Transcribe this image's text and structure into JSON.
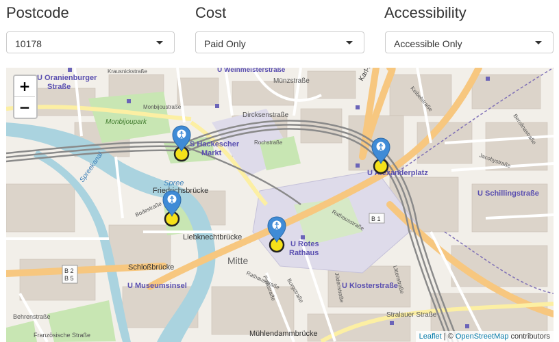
{
  "filters": {
    "postcode": {
      "label": "Postcode",
      "value": "10178"
    },
    "cost": {
      "label": "Cost",
      "value": "Paid Only"
    },
    "accessibility": {
      "label": "Accessibility",
      "value": "Accessible Only"
    }
  },
  "map": {
    "zoom_in": "+",
    "zoom_out": "−",
    "attribution": {
      "leaflet": "Leaflet",
      "sep": " | © ",
      "osm": "OpenStreetMap",
      "contributors": " contributors"
    },
    "labels": {
      "weinmeister": "U Weinmeisterstraße",
      "oranienburger": "U Oranienburger",
      "oranienburger2": "Straße",
      "muenz": "Münzstraße",
      "krausnick": "Krausnickstraße",
      "dircksen": "Dircksenstraße",
      "rochstr": "Rochstraße",
      "monbijoupark": "Monbijoupark",
      "monbijoustr": "Monbijoustraße",
      "hackescher": "S Hackescher",
      "hackescher2": "Markt",
      "alexanderplatz": "U Alexanderplatz",
      "friedrichsbruecke": "Friedrichsbrücke",
      "liebknechtbruecke": "Liebknechtbrücke",
      "spreekanal": "Spreekanal",
      "spree": "Spree",
      "mitte": "Mitte",
      "roter": "U Rotes",
      "roter2": "Rathaus",
      "schillingstr": "U Schillingstraße",
      "schlossbruecke": "Schloßbrücke",
      "museumsinsel": "U Museumsinsel",
      "klosterstr": "U Klosterstraße",
      "stralauer": "Stralauer Straße",
      "muehlendamm": "Mühlendammbrücke",
      "behrenstr": "Behrenstraße",
      "franzoesische": "Französische Straße",
      "b1": "B 1",
      "b2": "B 2",
      "b5": "B 5",
      "rathausstr": "Rathausstraße",
      "karlliebknecht": "Karl-L",
      "keibelstr": "Keibelstraße",
      "berolinastr": "Berolinastraße",
      "jacobystr": "Jacobystraße",
      "littenstr": "Littenstraße",
      "bodestr": "Bodestraße",
      "poststr": "Poststraße",
      "judenstr": "Jüdenstraße",
      "burgstr": "Burgstraße",
      "rathausstr2": "Rathausstraße",
      "dircksen2": "Dircksenstraße"
    },
    "markers": [
      {
        "name": "Hackescher Markt"
      },
      {
        "name": "Alexanderplatz"
      },
      {
        "name": "Museumsinsel"
      },
      {
        "name": "Rotes Rathaus"
      }
    ],
    "colors": {
      "marker_blue": "#3f8bd6",
      "marker_yellow": "#f5e11a",
      "rail": "#8a8a8a",
      "major_road": "#f7c77f",
      "water": "#aad3df",
      "park": "#c8e6b3"
    }
  }
}
